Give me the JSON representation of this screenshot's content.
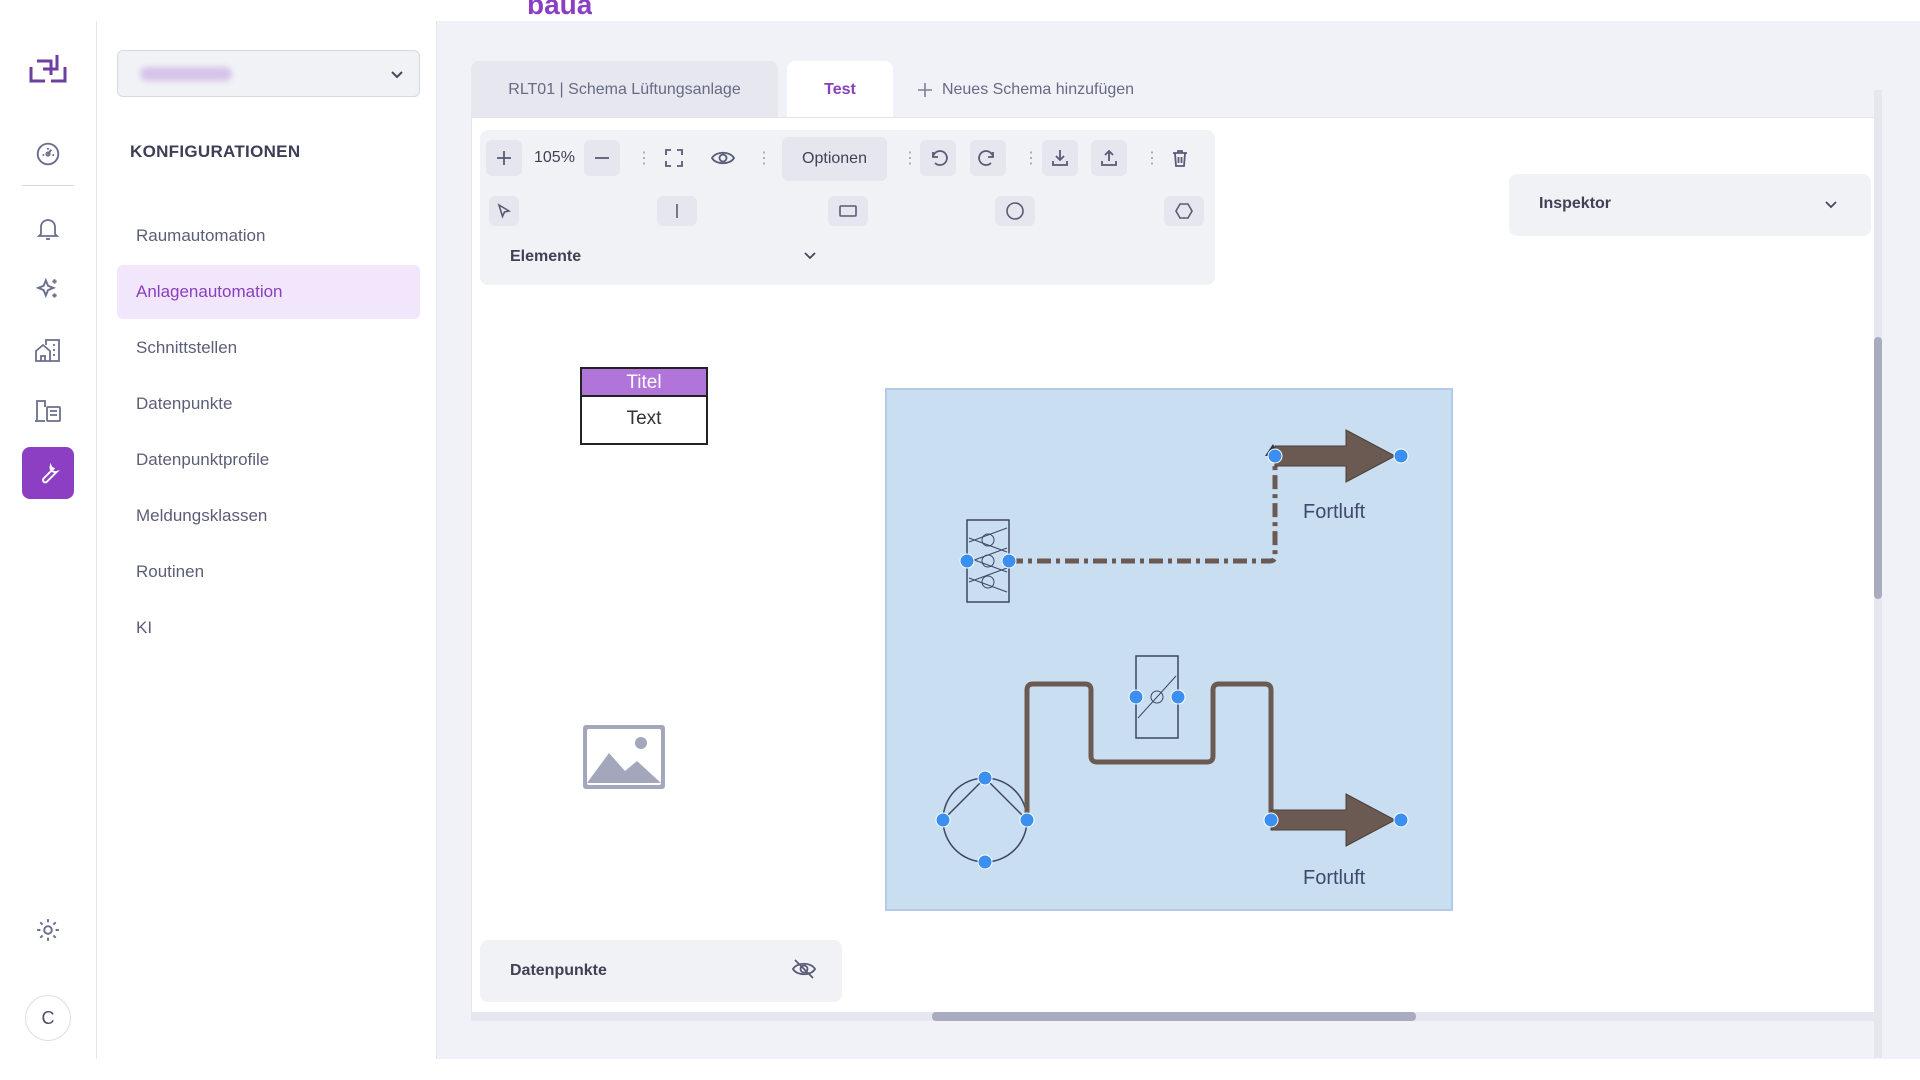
{
  "app": {
    "brand_peek": "baua"
  },
  "rail": {
    "avatar_initial": "C",
    "icons": [
      "logo-icon",
      "dashboard-icon",
      "bell-icon",
      "sparkles-icon",
      "buildings-icon",
      "building-list-icon",
      "wrench-icon",
      "gear-icon"
    ]
  },
  "config": {
    "section_title": "KONFIGURATIONEN",
    "items": [
      {
        "label": "Raumautomation"
      },
      {
        "label": "Anlagenautomation"
      },
      {
        "label": "Schnittstellen"
      },
      {
        "label": "Datenpunkte"
      },
      {
        "label": "Datenpunktprofile"
      },
      {
        "label": "Meldungsklassen"
      },
      {
        "label": "Routinen"
      },
      {
        "label": "KI"
      }
    ],
    "active_item": "Anlagenautomation"
  },
  "tabs": {
    "items": [
      {
        "label": "RLT01 | Schema Lüftungsanlage"
      },
      {
        "label": "Test"
      }
    ],
    "active": "Test",
    "add_label": "Neues Schema hinzufügen"
  },
  "toolbar": {
    "zoom": "105%",
    "options_label": "Optionen",
    "elements_label": "Elemente"
  },
  "inspector": {
    "label": "Inspektor"
  },
  "datapoints_panel": {
    "label": "Datenpunkte"
  },
  "canvas": {
    "title_box": {
      "title": "Titel",
      "text": "Text"
    },
    "diagram": {
      "labels": {
        "outlet_top": "Fortluft",
        "outlet_bottom": "Fortluft"
      }
    }
  },
  "colors": {
    "accent": "#8d3fc4",
    "active_bg": "#f1e6fb",
    "diagram_bg": "#cadef2",
    "pipe": "#6b5a52",
    "handle": "#3a8ff0"
  }
}
